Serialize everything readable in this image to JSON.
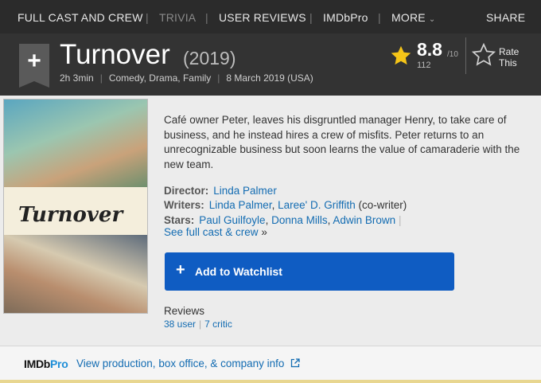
{
  "nav": {
    "items": [
      "FULL CAST AND CREW",
      "TRIVIA",
      "USER REVIEWS",
      "IMDbPro",
      "MORE"
    ],
    "separator": "|",
    "share": "SHARE"
  },
  "title": {
    "name": "Turnover",
    "year": "(2019)",
    "runtime": "2h 3min",
    "genres": "Comedy, Drama, Family",
    "release": "8 March 2019 (USA)",
    "meta_sep": "|"
  },
  "rating": {
    "value": "8.8",
    "out_of": "/10",
    "votes": "112",
    "rate_line1": "Rate",
    "rate_line2": "This"
  },
  "poster": {
    "title": "Turnover"
  },
  "synopsis": "Café owner Peter, leaves his disgruntled manager Henry, to take care of business, and he instead hires a crew of misfits. Peter returns to an unrecognizable business but soon learns the value of camaraderie with the new team.",
  "credits": {
    "director_label": "Director:",
    "director": "Linda Palmer",
    "writers_label": "Writers:",
    "writer1": "Linda Palmer",
    "writer_comma": ",",
    "writer2": "Laree' D. Griffith",
    "writer2_note": "(co-writer)",
    "stars_label": "Stars:",
    "star1": "Paul Guilfoyle",
    "star2": "Donna Mills",
    "star3": "Adwin Brown",
    "star_comma": ",",
    "star_sep": "|",
    "see_all": "See full cast & crew",
    "see_all_arrow": "»"
  },
  "watchlist": {
    "plus": "+",
    "label": "Add to Watchlist"
  },
  "reviews": {
    "heading": "Reviews",
    "user": "38 user",
    "sep": "|",
    "critic": "7 critic"
  },
  "footer": {
    "brand_imdb": "IMDb",
    "brand_pro": "Pro",
    "link": "View production, box office, & company info"
  },
  "colors": {
    "accent_blue": "#0f5cc2",
    "link_blue": "#136cb2",
    "star_gold": "#f5c518",
    "header_bg": "#333333"
  }
}
